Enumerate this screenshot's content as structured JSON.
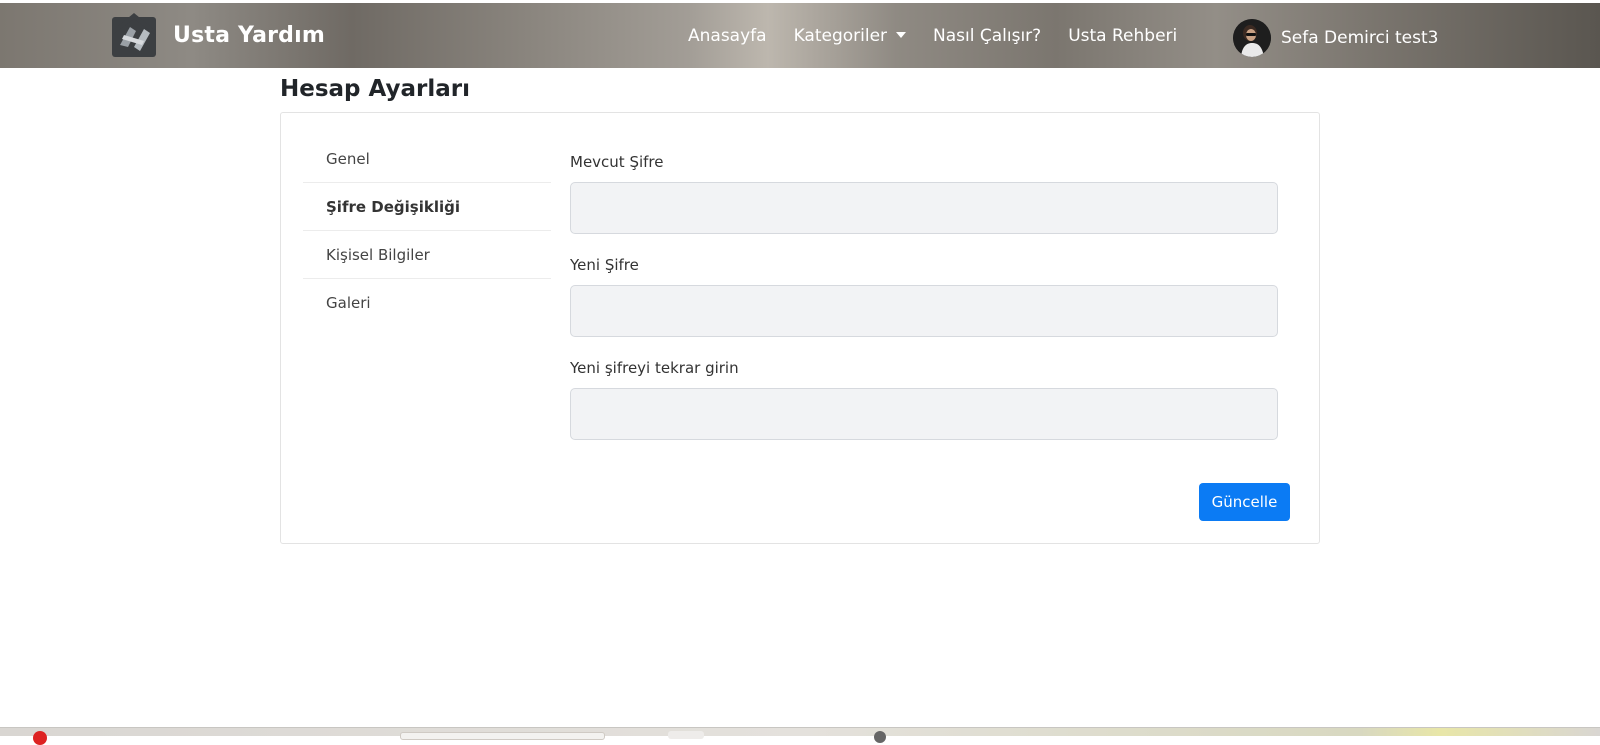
{
  "brand": {
    "name": "Usta Yardım",
    "logo_icon": "house-tools-logo-icon"
  },
  "nav": {
    "items": [
      {
        "label": "Anasayfa"
      },
      {
        "label": "Kategoriler",
        "has_dropdown": true
      },
      {
        "label": "Nasıl Çalışır?"
      },
      {
        "label": "Usta Rehberi"
      }
    ],
    "user": {
      "name": "Sefa Demirci test3",
      "avatar_icon": "user-avatar"
    }
  },
  "page": {
    "title": "Hesap Ayarları"
  },
  "sidebar": {
    "items": [
      {
        "label": "Genel",
        "active": false
      },
      {
        "label": "Şifre Değişikliği",
        "active": true
      },
      {
        "label": "Kişisel Bilgiler",
        "active": false
      },
      {
        "label": "Galeri",
        "active": false
      }
    ]
  },
  "form": {
    "current_password": {
      "label": "Mevcut Şifre",
      "value": "",
      "placeholder": ""
    },
    "new_password": {
      "label": "Yeni Şifre",
      "value": "",
      "placeholder": ""
    },
    "confirm_password": {
      "label": "Yeni şifreyi tekrar girin",
      "value": "",
      "placeholder": ""
    },
    "submit_label": "Güncelle"
  },
  "colors": {
    "primary_button": "#0b7bf4",
    "input_background": "#f2f3f5",
    "navbar_text": "#ffffff"
  }
}
